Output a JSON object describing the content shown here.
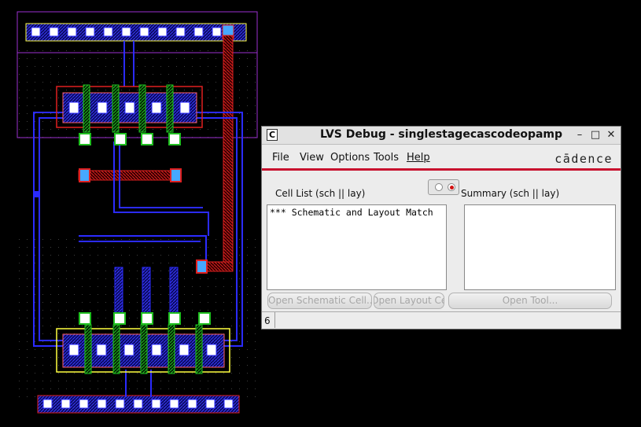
{
  "window": {
    "title": "LVS Debug - singlestagecascodeopamp",
    "app_icon": "C",
    "minimize_glyph": "–",
    "maximize_glyph": "□",
    "close_glyph": "✕"
  },
  "menu": {
    "file": "File",
    "view": "View",
    "options": "Options",
    "tools": "Tools",
    "help": "Help"
  },
  "brand": "cādence",
  "toggle": {
    "selected": "right"
  },
  "cell_list": {
    "label": "Cell List (sch || lay)",
    "items": [
      "*** Schematic and Layout Match"
    ]
  },
  "summary": {
    "label": "Summary (sch || lay)"
  },
  "buttons": {
    "open_schematic": "Open Schematic Cell...",
    "open_layout": "Open Layout Cell...",
    "open_tool": "Open Tool..."
  },
  "status": {
    "number": "6"
  },
  "colors": {
    "background": "#000000",
    "metal1": "#2b2bff",
    "metal2": "#e02020",
    "poly": "#20c020",
    "contact": "#ffffff",
    "well": "#9b30d0",
    "diffusion": "#e0e020",
    "accent_red": "#c8102e"
  },
  "icons": [
    "app-c-icon",
    "minimize-icon",
    "maximize-icon",
    "close-icon",
    "radio-icon"
  ]
}
